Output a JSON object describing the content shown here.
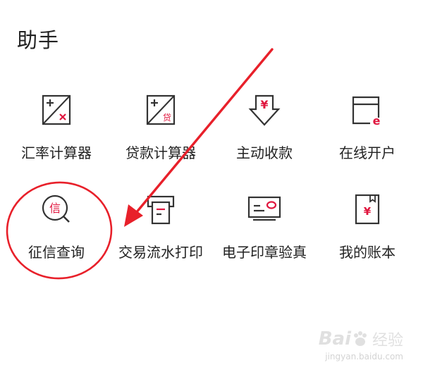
{
  "section": {
    "title": "助手"
  },
  "tools": [
    {
      "label": "汇率计算器",
      "icon": "exchange-calculator-icon"
    },
    {
      "label": "贷款计算器",
      "icon": "loan-calculator-icon"
    },
    {
      "label": "主动收款",
      "icon": "receive-payment-icon"
    },
    {
      "label": "在线开户",
      "icon": "online-account-opening-icon"
    },
    {
      "label": "征信查询",
      "icon": "credit-inquiry-icon"
    },
    {
      "label": "交易流水打印",
      "icon": "transaction-print-icon"
    },
    {
      "label": "电子印章验真",
      "icon": "e-seal-verify-icon"
    },
    {
      "label": "我的账本",
      "icon": "my-ledger-icon"
    }
  ],
  "icon_glyphs": {
    "credit": "信",
    "loan": "贷",
    "yen": "¥",
    "e": "e"
  },
  "watermark": {
    "logo_a": "Bai",
    "logo_b": "经验",
    "url": "jingyan.baidu.com"
  },
  "colors": {
    "accent": "#e0163e",
    "icon_stroke": "#333333",
    "annotation": "#e8202a",
    "text": "#222222"
  }
}
